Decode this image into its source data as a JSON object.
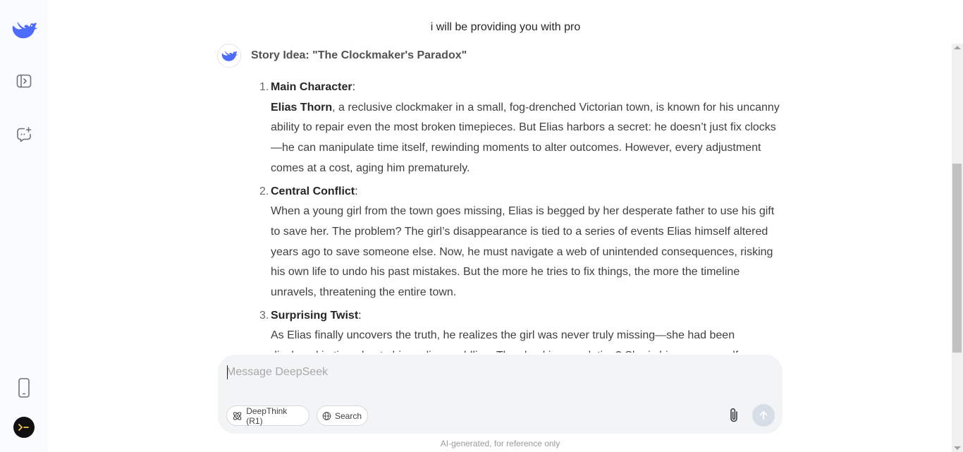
{
  "sidebar": {
    "logo_icon": "deepseek-whale-logo",
    "toggle_icon": "sidebar-toggle-icon",
    "new_chat_icon": "new-chat-icon",
    "mobile_icon": "mobile-phone-icon",
    "avatar_icon": "terminal-prompt-icon"
  },
  "chat": {
    "title": "i will be providing you with pro"
  },
  "message": {
    "heading": "Story Idea: \"The Clockmaker's Paradox\"",
    "items": [
      {
        "number": "1.",
        "title": "Main Character",
        "colon": ":",
        "lead": "Elias Thorn",
        "text": ", a reclusive clockmaker in a small, fog-drenched Victorian town, is known for his uncanny ability to repair even the most broken timepieces. But Elias harbors a secret: he doesn’t just fix clocks—he can manipulate time itself, rewinding moments to alter outcomes. However, every adjustment comes at a cost, aging him prematurely."
      },
      {
        "number": "2.",
        "title": "Central Conflict",
        "colon": ":",
        "lead": "",
        "text": "When a young girl from the town goes missing, Elias is begged by her desperate father to use his gift to save her. The problem? The girl’s disappearance is tied to a series of events Elias himself altered years ago to save someone else. Now, he must navigate a web of unintended consequences, risking his own life to undo his past mistakes. But the more he tries to fix things, the more the timeline unravels, threatening the entire town."
      },
      {
        "number": "3.",
        "title": "Surprising Twist",
        "colon": ":",
        "lead": "",
        "text": "As Elias finally uncovers the truth, he realizes the girl was never truly missing—she had been displaced in time due to his earlier meddling. The shocking revelation? She is his younger self, trapped in a loop"
      }
    ]
  },
  "composer": {
    "placeholder": "Message DeepSeek",
    "deepthink_label": "DeepThink (R1)",
    "search_label": "Search",
    "attach_icon": "paperclip-icon",
    "send_icon": "arrow-up-icon"
  },
  "footer": {
    "note": "AI-generated, for reference only"
  },
  "colors": {
    "brand": "#4d6bfe",
    "sidebar_bg": "#f9fbff",
    "composer_bg": "#f3f4f6",
    "send_disabled": "#d6dee8"
  }
}
